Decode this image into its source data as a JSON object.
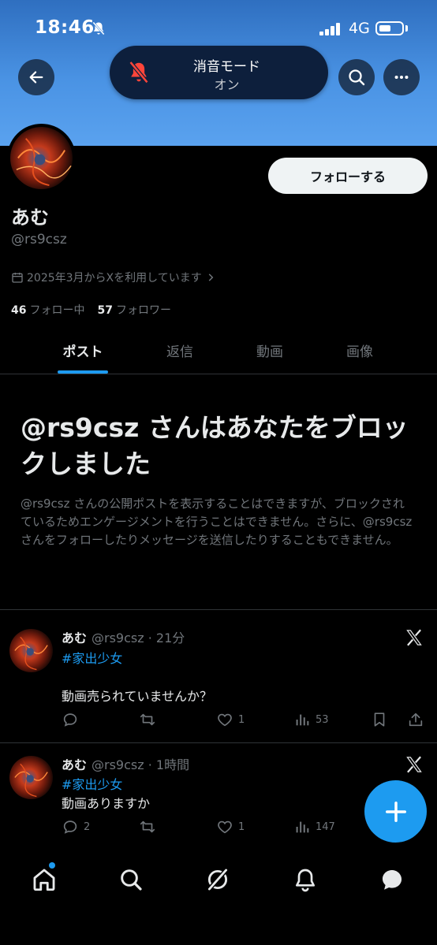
{
  "status_bar": {
    "time": "18:46",
    "network": "4G"
  },
  "silent_mode": {
    "title": "消音モード",
    "state": "オン"
  },
  "profile": {
    "follow_label": "フォローする",
    "display_name": "あむ",
    "handle": "@rs9csz",
    "joined": "2025年3月からXを利用しています",
    "following_count": "46",
    "following_label": "フォロー中",
    "followers_count": "57",
    "followers_label": "フォロワー"
  },
  "tabs": [
    {
      "label": "ポスト",
      "active": true
    },
    {
      "label": "返信",
      "active": false
    },
    {
      "label": "動画",
      "active": false
    },
    {
      "label": "画像",
      "active": false
    }
  ],
  "blocked": {
    "title": "@rs9csz さんはあなたをブロックしました",
    "description": "@rs9csz さんの公開ポストを表示することはできますが、ブロックされているためエンゲージメントを行うことはできません。さらに、@rs9csz さんをフォローしたりメッセージを送信したりすることもできません。"
  },
  "posts": [
    {
      "name": "あむ",
      "handle": "@rs9csz",
      "time": "21分",
      "hashtag": "#家出少女",
      "text": "動画売られていませんか？",
      "replies": "",
      "reposts": "",
      "likes": "1",
      "views": "53"
    },
    {
      "name": "あむ",
      "handle": "@rs9csz",
      "time": "1時間",
      "hashtag": "#家出少女",
      "text": "動画ありますか",
      "replies": "2",
      "reposts": "",
      "likes": "1",
      "views": "147"
    }
  ],
  "colors": {
    "accent": "#1d9bf0",
    "background": "#000000",
    "muted": "#71767b",
    "banner": "#4a93e4",
    "silent_red": "#ff453a"
  },
  "icons": [
    "back-arrow-icon",
    "search-icon",
    "more-icon",
    "bell-slash-icon",
    "calendar-icon",
    "chevron-right-icon",
    "x-logo-icon",
    "reply-icon",
    "repost-icon",
    "like-icon",
    "views-icon",
    "bookmark-icon",
    "share-icon",
    "compose-plus-icon",
    "home-icon",
    "grok-icon",
    "notifications-icon",
    "messages-icon"
  ]
}
